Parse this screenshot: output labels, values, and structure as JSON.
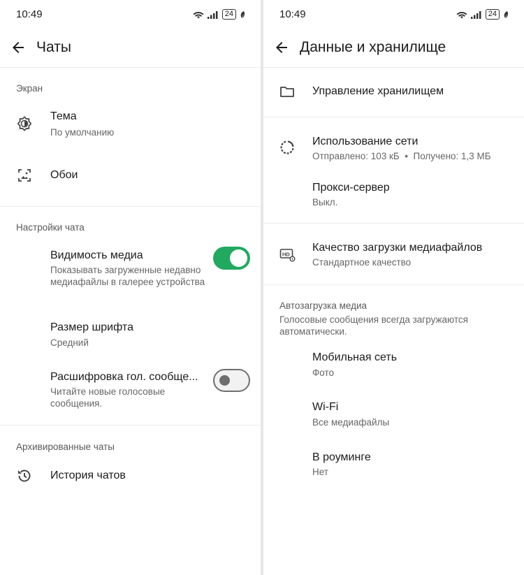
{
  "left": {
    "status": {
      "time": "10:49",
      "battery": "24"
    },
    "appbar": {
      "title": "Чаты"
    },
    "screen_section": "Экран",
    "theme": {
      "title": "Тема",
      "subtitle": "По умолчанию"
    },
    "wallpaper": {
      "title": "Обои"
    },
    "chat_settings_section": "Настройки чата",
    "media_visibility": {
      "title": "Видимость медиа",
      "subtitle": "Показывать загруженные недавно медиафайлы в галерее устройства",
      "enabled": true
    },
    "font_size": {
      "title": "Размер шрифта",
      "subtitle": "Средний"
    },
    "voice_transcription": {
      "title": "Расшифровка гол. сообще...",
      "subtitle": "Читайте новые голосовые сообщения.",
      "enabled": false
    },
    "archived_section": "Архивированные чаты",
    "chat_history": {
      "title": "История чатов"
    }
  },
  "right": {
    "status": {
      "time": "10:49",
      "battery": "24"
    },
    "appbar": {
      "title": "Данные и хранилище"
    },
    "manage_storage": {
      "title": "Управление хранилищем"
    },
    "network_usage": {
      "title": "Использование сети",
      "subtitle": "Отправлено: 103 кБ  •  Получено: 1,3 МБ"
    },
    "proxy": {
      "title": "Прокси-сервер",
      "subtitle": "Выкл."
    },
    "media_quality": {
      "title": "Качество загрузки медиафайлов",
      "subtitle": "Стандартное качество"
    },
    "autodownload_section": "Автозагрузка медиа",
    "autodownload_desc": "Голосовые сообщения всегда загружаются автоматически.",
    "mobile": {
      "title": "Мобильная сеть",
      "subtitle": "Фото"
    },
    "wifi": {
      "title": "Wi-Fi",
      "subtitle": "Все медиафайлы"
    },
    "roaming": {
      "title": "В роуминге",
      "subtitle": "Нет"
    }
  },
  "colors": {
    "toggle_on": "#21a960",
    "toggle_off_border": "#6f6f6f"
  }
}
